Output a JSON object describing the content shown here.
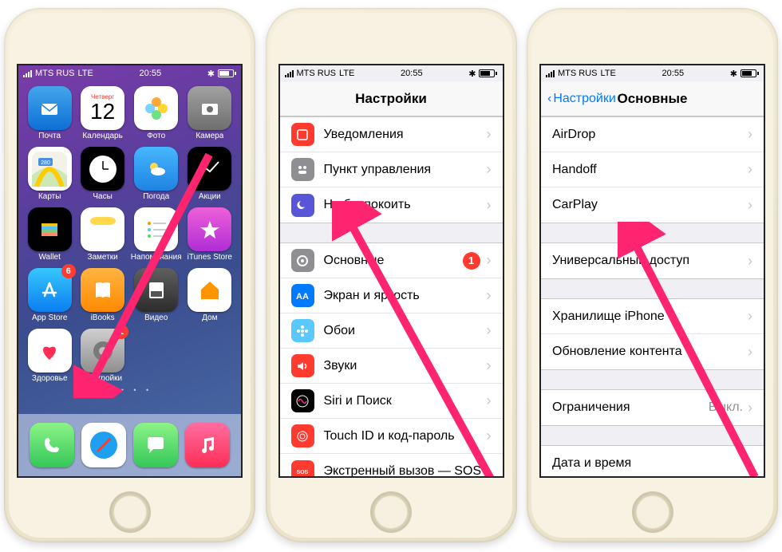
{
  "status": {
    "carrier": "MTS RUS",
    "network": "LTE",
    "time": "20:55",
    "bluetooth": "✱"
  },
  "phone1": {
    "apps": [
      {
        "label": "Почта",
        "color": "linear-gradient(#44a6eb,#0c70d5)",
        "glyph": "mail"
      },
      {
        "label": "Календарь",
        "color": "#fff",
        "glyph": "calendar",
        "day": "12",
        "weekday": "Четверг"
      },
      {
        "label": "Фото",
        "color": "#fff",
        "glyph": "photos"
      },
      {
        "label": "Камера",
        "color": "linear-gradient(#a1a1a1,#6f6f6f)",
        "glyph": "camera"
      },
      {
        "label": "Карты",
        "color": "#fff",
        "glyph": "maps"
      },
      {
        "label": "Часы",
        "color": "#000",
        "glyph": "clock"
      },
      {
        "label": "Погода",
        "color": "linear-gradient(#47b7ff,#1e83e2)",
        "glyph": "weather"
      },
      {
        "label": "Акции",
        "color": "#000",
        "glyph": "stocks"
      },
      {
        "label": "Wallet",
        "color": "#000",
        "glyph": "wallet"
      },
      {
        "label": "Заметки",
        "color": "#fff",
        "glyph": "notes"
      },
      {
        "label": "Напоминания",
        "color": "#fff",
        "glyph": "reminders"
      },
      {
        "label": "iTunes Store",
        "color": "linear-gradient(#ef60d8,#b02dd6)",
        "glyph": "star"
      },
      {
        "label": "App Store",
        "color": "linear-gradient(#37c7fc,#0a7ef0)",
        "glyph": "appstore",
        "badge": "6"
      },
      {
        "label": "iBooks",
        "color": "linear-gradient(#ffb443,#ff8a00)",
        "glyph": "book"
      },
      {
        "label": "Видео",
        "color": "linear-gradient(#5f5f5f,#2c2c2c)",
        "glyph": "video"
      },
      {
        "label": "Дом",
        "color": "#fff",
        "glyph": "home"
      },
      {
        "label": "Здоровье",
        "color": "#fff",
        "glyph": "health"
      },
      {
        "label": "Настройки",
        "color": "linear-gradient(#cfcfcf,#8f8f8f)",
        "glyph": "gear",
        "badge": "1"
      }
    ],
    "dock": [
      {
        "glyph": "phone",
        "color": "linear-gradient(#8df387,#34c759)"
      },
      {
        "glyph": "safari",
        "color": "#fff"
      },
      {
        "glyph": "messages",
        "color": "linear-gradient(#8df387,#34c759)"
      },
      {
        "glyph": "music",
        "color": "linear-gradient(#ff6ea0,#ff2d55)"
      }
    ]
  },
  "phone2": {
    "title": "Настройки",
    "section1": [
      {
        "label": "Уведомления",
        "iconBg": "#ff3b30",
        "glyph": "notif"
      },
      {
        "label": "Пункт управления",
        "iconBg": "#8e8e93",
        "glyph": "cc"
      },
      {
        "label": "Не беспокоить",
        "iconBg": "#5856d6",
        "glyph": "dnd"
      }
    ],
    "section2": [
      {
        "label": "Основные",
        "iconBg": "#8e8e93",
        "glyph": "gear",
        "badge": "1"
      },
      {
        "label": "Экран и яркость",
        "iconBg": "#007aff",
        "glyph": "aa"
      },
      {
        "label": "Обои",
        "iconBg": "#5ac8fa",
        "glyph": "flower"
      },
      {
        "label": "Звуки",
        "iconBg": "#ff3b30",
        "glyph": "sound"
      },
      {
        "label": "Siri и Поиск",
        "iconBg": "#000",
        "glyph": "siri"
      },
      {
        "label": "Touch ID и код-пароль",
        "iconBg": "#ff3b30",
        "glyph": "touch"
      },
      {
        "label": "Экстренный вызов — SOS",
        "iconBg": "#ff3b30",
        "glyph": "sos"
      }
    ]
  },
  "phone3": {
    "backLabel": "Настройки",
    "title": "Основные",
    "section1": [
      {
        "label": "AirDrop"
      },
      {
        "label": "Handoff"
      },
      {
        "label": "CarPlay"
      }
    ],
    "section2": [
      {
        "label": "Универсальный доступ"
      }
    ],
    "section3": [
      {
        "label": "Хранилище iPhone"
      },
      {
        "label": "Обновление контента"
      }
    ],
    "section4": [
      {
        "label": "Ограничения",
        "value": "Выкл."
      }
    ],
    "section5": [
      {
        "label": "Дата и время"
      }
    ]
  }
}
